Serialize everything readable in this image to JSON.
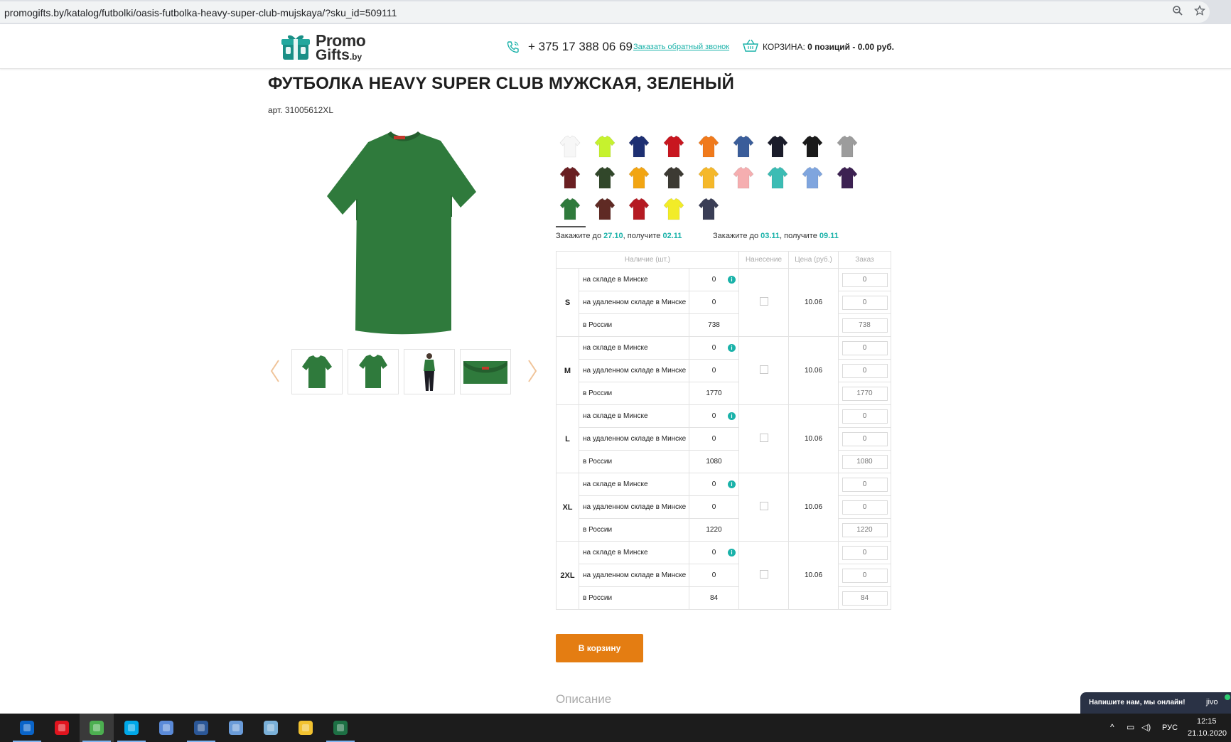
{
  "browser": {
    "url": "promogifts.by/katalog/futbolki/oasis-futbolka-heavy-super-club-mujskaya/?sku_id=509111"
  },
  "header": {
    "logo_line1": "Promo",
    "logo_line2": "Gifts",
    "logo_suffix": ".by",
    "phone": "+ 375 17 388 06 69",
    "callback_label": "Заказать обратный звонок",
    "cart_label": "КОРЗИНА:",
    "cart_summary": "0 позиций - 0.00 руб."
  },
  "product": {
    "title": "ФУТБОЛКА HEAVY SUPER CLUB МУЖСКАЯ, ЗЕЛЕНЫЙ",
    "sku": "арт. 31005612XL",
    "shirt_color": "#2f7a3c"
  },
  "swatches": [
    {
      "color": "#f7f7f7"
    },
    {
      "color": "#c6f22e"
    },
    {
      "color": "#1d2f72"
    },
    {
      "color": "#c8161f"
    },
    {
      "color": "#f07a1c"
    },
    {
      "color": "#3a5d9a"
    },
    {
      "color": "#1a1c2a"
    },
    {
      "color": "#1a1a1a"
    },
    {
      "color": "#9c9c9c"
    },
    {
      "color": "#6a1f22"
    },
    {
      "color": "#31472a"
    },
    {
      "color": "#f2a512"
    },
    {
      "color": "#3c3a33"
    },
    {
      "color": "#f5b82a"
    },
    {
      "color": "#f5aeb0"
    },
    {
      "color": "#3cbcb4"
    },
    {
      "color": "#7fa5de"
    },
    {
      "color": "#3c2152"
    },
    {
      "color": "#2f7a3c",
      "selected": true
    },
    {
      "color": "#5f2a24"
    },
    {
      "color": "#b51a22"
    },
    {
      "color": "#f2ec28"
    },
    {
      "color": "#3a3e56"
    }
  ],
  "delivery": [
    {
      "prefix": "Закажите до",
      "order_by": "27.10",
      "middle": ", получите",
      "receive": "02.11"
    },
    {
      "prefix": "Закажите до",
      "order_by": "03.11",
      "middle": ", получите",
      "receive": "09.11"
    }
  ],
  "table": {
    "headers": {
      "stock": "Наличие (шт.)",
      "print": "Нанесение",
      "price": "Цена (руб.)",
      "order": "Заказ"
    },
    "info_glyph": "i",
    "sizes": [
      {
        "size": "S",
        "price": "10.06",
        "rows": [
          {
            "loc": "на складе в Минске",
            "qty": "0",
            "order": "0"
          },
          {
            "loc": "на удаленном складе в Минске",
            "qty": "0",
            "order": "0"
          },
          {
            "loc": "в России",
            "qty": "738",
            "order": "738"
          }
        ]
      },
      {
        "size": "M",
        "price": "10.06",
        "rows": [
          {
            "loc": "на складе в Минске",
            "qty": "0",
            "order": "0"
          },
          {
            "loc": "на удаленном складе в Минске",
            "qty": "0",
            "order": "0"
          },
          {
            "loc": "в России",
            "qty": "1770",
            "order": "1770"
          }
        ]
      },
      {
        "size": "L",
        "price": "10.06",
        "rows": [
          {
            "loc": "на складе в Минске",
            "qty": "0",
            "order": "0"
          },
          {
            "loc": "на удаленном складе в Минске",
            "qty": "0",
            "order": "0"
          },
          {
            "loc": "в России",
            "qty": "1080",
            "order": "1080"
          }
        ]
      },
      {
        "size": "XL",
        "price": "10.06",
        "rows": [
          {
            "loc": "на складе в Минске",
            "qty": "0",
            "order": "0"
          },
          {
            "loc": "на удаленном складе в Минске",
            "qty": "0",
            "order": "0"
          },
          {
            "loc": "в России",
            "qty": "1220",
            "order": "1220"
          }
        ]
      },
      {
        "size": "2XL",
        "price": "10.06",
        "rows": [
          {
            "loc": "на складе в Минске",
            "qty": "0",
            "order": "0"
          },
          {
            "loc": "на удаленном складе в Минске",
            "qty": "0",
            "order": "0"
          },
          {
            "loc": "в России",
            "qty": "84",
            "order": "84"
          }
        ]
      }
    ]
  },
  "cart_button": "В корзину",
  "description_heading": "Описание",
  "chat": {
    "text": "Напишите нам, мы онлайн!",
    "brand": "jivo"
  },
  "taskbar": {
    "apps": [
      {
        "icon": "outlook-icon",
        "color": "#0a64c8",
        "running": true
      },
      {
        "icon": "opera-icon",
        "color": "#e0141e"
      },
      {
        "icon": "chrome-icon",
        "color": "#4caf50",
        "active": true,
        "running": true
      },
      {
        "icon": "skype-icon",
        "color": "#00a8e8",
        "running": true
      },
      {
        "icon": "network-app-icon",
        "color": "#5a8ad8"
      },
      {
        "icon": "word-icon",
        "color": "#2b5797",
        "running": true
      },
      {
        "icon": "presentation-app-icon",
        "color": "#6a9bd8"
      },
      {
        "icon": "notepad-app-icon",
        "color": "#7ab0d8"
      },
      {
        "icon": "1c-icon",
        "color": "#f2c230"
      },
      {
        "icon": "excel-icon",
        "color": "#1d7044",
        "running": true
      }
    ],
    "tray": {
      "chevron": "^",
      "network": "▭",
      "volume": "◁)",
      "lang": "РУС",
      "time": "12:15",
      "date": "21.10.2020"
    }
  }
}
